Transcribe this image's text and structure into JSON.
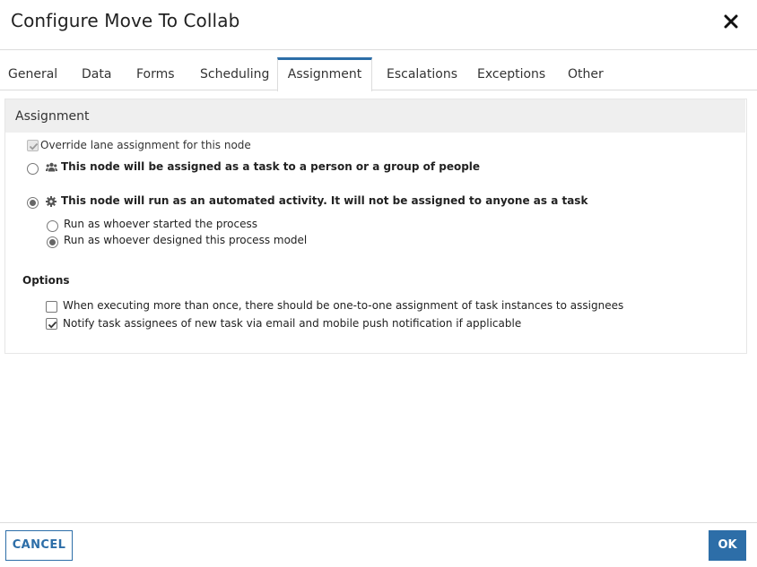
{
  "dialog": {
    "title": "Configure Move To Collab",
    "close_icon": "close-icon"
  },
  "tabs": [
    {
      "label": "General"
    },
    {
      "label": "Data"
    },
    {
      "label": "Forms"
    },
    {
      "label": "Scheduling"
    },
    {
      "label": "Assignment",
      "active": true
    },
    {
      "label": "Escalations"
    },
    {
      "label": "Exceptions"
    },
    {
      "label": "Other"
    }
  ],
  "assignment": {
    "section_title": "Assignment",
    "override_label": "Override lane assignment for this node",
    "override_checked": true,
    "override_disabled": true,
    "option_person": "This node will be assigned as a task to a person or a group of people",
    "option_person_icon": "users-icon",
    "option_automated": "This node will run as an automated activity. It will not be assigned to anyone as a task",
    "option_automated_icon": "gear-icon",
    "selected": "automated",
    "run_as_started": "Run as whoever started the process",
    "run_as_designed": "Run as whoever designed this process model",
    "run_as_selected": "designed"
  },
  "options": {
    "title": "Options",
    "one_to_one": {
      "label": "When executing more than once, there should be one-to-one assignment of task instances to assignees",
      "checked": false
    },
    "notify": {
      "label": "Notify task assignees of new task via email and mobile push notification if applicable",
      "checked": true
    }
  },
  "footer": {
    "cancel_label": "CANCEL",
    "ok_label": "OK"
  },
  "colors": {
    "accent": "#2d6ea8",
    "section_header_bg": "#efefef"
  }
}
